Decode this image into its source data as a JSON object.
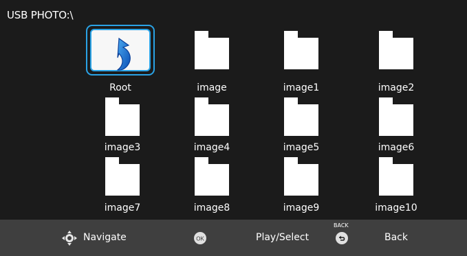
{
  "header": {
    "path": "USB PHOTO:\\"
  },
  "items": [
    {
      "label": "Root"
    },
    {
      "label": "image"
    },
    {
      "label": "image1"
    },
    {
      "label": "image2"
    },
    {
      "label": "image3"
    },
    {
      "label": "image4"
    },
    {
      "label": "image5"
    },
    {
      "label": "image6"
    },
    {
      "label": "image7"
    },
    {
      "label": "image8"
    },
    {
      "label": "image9"
    },
    {
      "label": "image10"
    }
  ],
  "footer": {
    "navigate_label": "Navigate",
    "play_select_label": "Play/Select",
    "back_label": "Back",
    "ok_key": "OK",
    "back_caption": "BACK"
  },
  "colors": {
    "focus": "#2aa3e6",
    "background": "#1b1b1b",
    "bar": "#3f3f3f"
  }
}
